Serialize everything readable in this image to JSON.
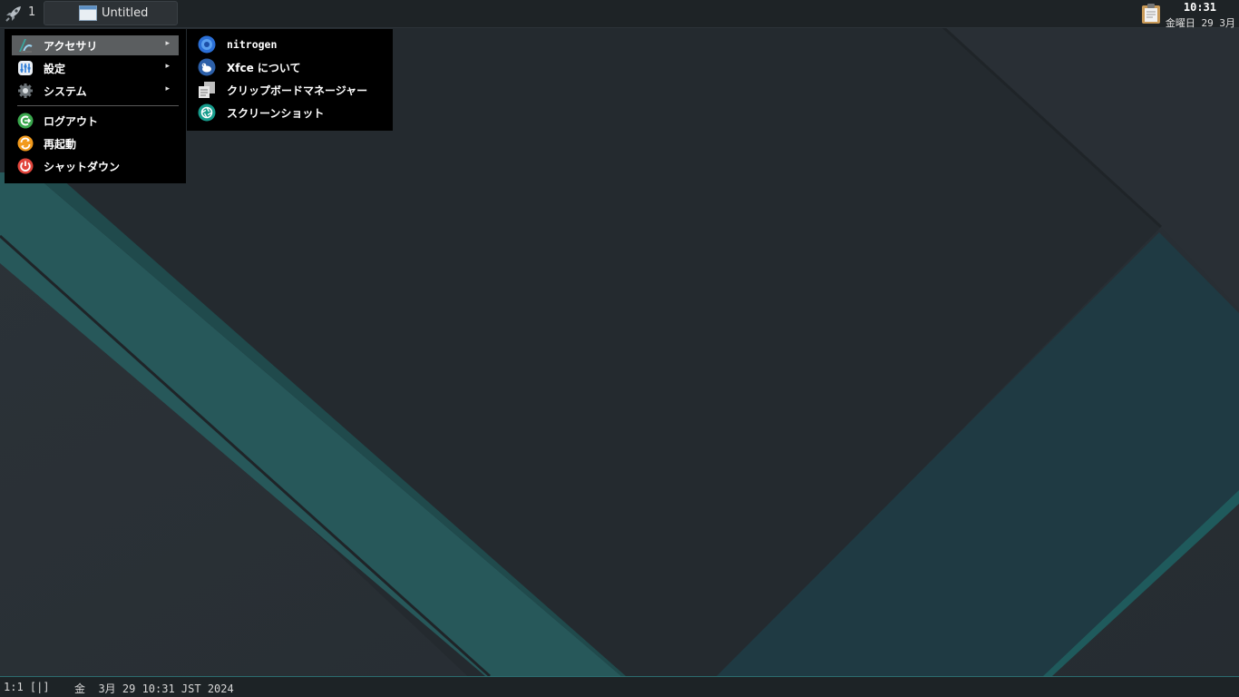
{
  "top_panel": {
    "workspace_number": "1",
    "taskbar_window_title": "Untitled",
    "clock_time": "10:31",
    "clock_date": "金曜日 29 3月",
    "icons": [
      "rocket-icon",
      "window-icon",
      "clipboard-icon"
    ]
  },
  "main_menu": {
    "items": [
      {
        "label": "アクセサリ",
        "icon": "accessories-icon",
        "has_submenu": true,
        "active": true
      },
      {
        "label": "設定",
        "icon": "settings-icon",
        "has_submenu": true
      },
      {
        "label": "システム",
        "icon": "system-gear-icon",
        "has_submenu": true
      },
      {
        "label": "ログアウト",
        "icon": "logout-icon",
        "has_submenu": false
      },
      {
        "label": "再起動",
        "icon": "restart-icon",
        "has_submenu": false
      },
      {
        "label": "シャットダウン",
        "icon": "shutdown-icon",
        "has_submenu": false
      }
    ],
    "submenu_arrow": "▸"
  },
  "submenu": {
    "items": [
      {
        "label": "nitrogen",
        "icon": "nitrogen-icon"
      },
      {
        "label": "Xfce について",
        "icon": "xfce-icon"
      },
      {
        "label": "クリップボードマネージャー",
        "icon": "clipboard-manager-icon"
      },
      {
        "label": "スクリーンショット",
        "icon": "screenshot-icon"
      }
    ]
  },
  "bottom_bar": {
    "layout": "1:1 [|]",
    "datetime": "金  3月 29 10:31 JST 2024"
  },
  "colors": {
    "panel": "#1e2326",
    "menu_bg": "#000000",
    "menu_active": "#5b5e60",
    "teal_stripe": "#2a6062",
    "bottom_border": "#2b6b6e"
  }
}
